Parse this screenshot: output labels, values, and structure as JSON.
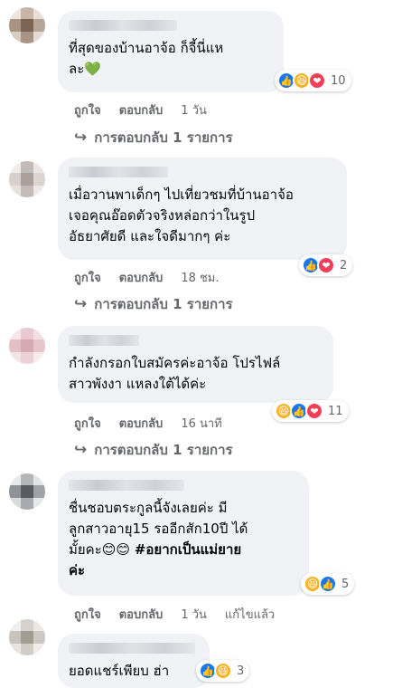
{
  "comments": [
    {
      "text": "ที่สุดของบ้านอาจ้อ ก็จี้นี่แห\nละ",
      "emoji": "💚",
      "reaction_count": "10",
      "like_label": "ถูกใจ",
      "reply_label": "ตอบกลับ",
      "time": "1 วัน",
      "replies_label": "การตอบกลับ 1 รายการ"
    },
    {
      "text": "เมื่อวานพาเด็กๆ ไปเที่ยวชมที่บ้านอาจ้อ\nเจอคุณอ๊อดตัวจริงหล่อกว่าในรูป\nอัธยาศัยดี และใจดีมากๆ ค่ะ",
      "reaction_count": "2",
      "like_label": "ถูกใจ",
      "reply_label": "ตอบกลับ",
      "time": "18 ชม.",
      "replies_label": "การตอบกลับ 1 รายการ"
    },
    {
      "text": "กำลังกรอกใบสมัครค่ะอาจ้อ โปรไฟล์\nสาวพังงา แหลงใต้ได้ค่ะ",
      "reaction_count": "11",
      "like_label": "ถูกใจ",
      "reply_label": "ตอบกลับ",
      "time": "16 นาที",
      "replies_label": "การตอบกลับ 1 รายการ"
    },
    {
      "text": "ชื่นชอบตระกูลนี้จังเลยค่ะ มี\nลูกสาวอายุ15 รออีกสัก10ปี ได้\nมั้ยคะ",
      "emoji": "😊😊",
      "hashtag": "#อยากเป็นแม่ยาย\nค่ะ",
      "reaction_count": "5",
      "like_label": "ถูกใจ",
      "reply_label": "ตอบกลับ",
      "time": "1 วัน",
      "edited_label": "แก้ไขแล้ว"
    },
    {
      "text": "ยอดแชร์เพียบ ฮ่า",
      "reaction_count": "3"
    }
  ]
}
